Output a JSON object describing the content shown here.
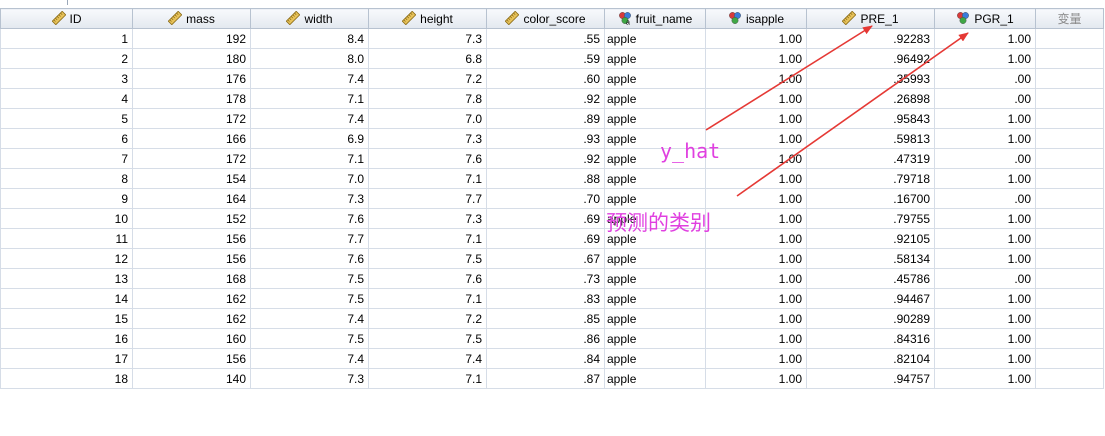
{
  "columns": [
    {
      "label": "ID",
      "icon": "ruler-icon"
    },
    {
      "label": "mass",
      "icon": "ruler-icon"
    },
    {
      "label": "width",
      "icon": "ruler-icon"
    },
    {
      "label": "height",
      "icon": "ruler-icon"
    },
    {
      "label": "color_score",
      "icon": "ruler-icon"
    },
    {
      "label": "fruit_name",
      "icon": "nominal-string-icon"
    },
    {
      "label": "isapple",
      "icon": "nominal-icon"
    },
    {
      "label": "PRE_1",
      "icon": "ruler-icon"
    },
    {
      "label": "PGR_1",
      "icon": "nominal-icon"
    },
    {
      "label": "变量",
      "icon": ""
    }
  ],
  "rows": [
    {
      "id": "1",
      "mass": "192",
      "width": "8.4",
      "height": "7.3",
      "color_score": ".55",
      "fruit_name": "apple",
      "isapple": "1.00",
      "pre_1": ".92283",
      "pgr_1": "1.00"
    },
    {
      "id": "2",
      "mass": "180",
      "width": "8.0",
      "height": "6.8",
      "color_score": ".59",
      "fruit_name": "apple",
      "isapple": "1.00",
      "pre_1": ".96492",
      "pgr_1": "1.00"
    },
    {
      "id": "3",
      "mass": "176",
      "width": "7.4",
      "height": "7.2",
      "color_score": ".60",
      "fruit_name": "apple",
      "isapple": "1.00",
      "pre_1": ".35993",
      "pgr_1": ".00"
    },
    {
      "id": "4",
      "mass": "178",
      "width": "7.1",
      "height": "7.8",
      "color_score": ".92",
      "fruit_name": "apple",
      "isapple": "1.00",
      "pre_1": ".26898",
      "pgr_1": ".00"
    },
    {
      "id": "5",
      "mass": "172",
      "width": "7.4",
      "height": "7.0",
      "color_score": ".89",
      "fruit_name": "apple",
      "isapple": "1.00",
      "pre_1": ".95843",
      "pgr_1": "1.00"
    },
    {
      "id": "6",
      "mass": "166",
      "width": "6.9",
      "height": "7.3",
      "color_score": ".93",
      "fruit_name": "apple",
      "isapple": "1.00",
      "pre_1": ".59813",
      "pgr_1": "1.00"
    },
    {
      "id": "7",
      "mass": "172",
      "width": "7.1",
      "height": "7.6",
      "color_score": ".92",
      "fruit_name": "apple",
      "isapple": "1.00",
      "pre_1": ".47319",
      "pgr_1": ".00"
    },
    {
      "id": "8",
      "mass": "154",
      "width": "7.0",
      "height": "7.1",
      "color_score": ".88",
      "fruit_name": "apple",
      "isapple": "1.00",
      "pre_1": ".79718",
      "pgr_1": "1.00"
    },
    {
      "id": "9",
      "mass": "164",
      "width": "7.3",
      "height": "7.7",
      "color_score": ".70",
      "fruit_name": "apple",
      "isapple": "1.00",
      "pre_1": ".16700",
      "pgr_1": ".00"
    },
    {
      "id": "10",
      "mass": "152",
      "width": "7.6",
      "height": "7.3",
      "color_score": ".69",
      "fruit_name": "apple",
      "isapple": "1.00",
      "pre_1": ".79755",
      "pgr_1": "1.00"
    },
    {
      "id": "11",
      "mass": "156",
      "width": "7.7",
      "height": "7.1",
      "color_score": ".69",
      "fruit_name": "apple",
      "isapple": "1.00",
      "pre_1": ".92105",
      "pgr_1": "1.00"
    },
    {
      "id": "12",
      "mass": "156",
      "width": "7.6",
      "height": "7.5",
      "color_score": ".67",
      "fruit_name": "apple",
      "isapple": "1.00",
      "pre_1": ".58134",
      "pgr_1": "1.00"
    },
    {
      "id": "13",
      "mass": "168",
      "width": "7.5",
      "height": "7.6",
      "color_score": ".73",
      "fruit_name": "apple",
      "isapple": "1.00",
      "pre_1": ".45786",
      "pgr_1": ".00"
    },
    {
      "id": "14",
      "mass": "162",
      "width": "7.5",
      "height": "7.1",
      "color_score": ".83",
      "fruit_name": "apple",
      "isapple": "1.00",
      "pre_1": ".94467",
      "pgr_1": "1.00"
    },
    {
      "id": "15",
      "mass": "162",
      "width": "7.4",
      "height": "7.2",
      "color_score": ".85",
      "fruit_name": "apple",
      "isapple": "1.00",
      "pre_1": ".90289",
      "pgr_1": "1.00"
    },
    {
      "id": "16",
      "mass": "160",
      "width": "7.5",
      "height": "7.5",
      "color_score": ".86",
      "fruit_name": "apple",
      "isapple": "1.00",
      "pre_1": ".84316",
      "pgr_1": "1.00"
    },
    {
      "id": "17",
      "mass": "156",
      "width": "7.4",
      "height": "7.4",
      "color_score": ".84",
      "fruit_name": "apple",
      "isapple": "1.00",
      "pre_1": ".82104",
      "pgr_1": "1.00"
    },
    {
      "id": "18",
      "mass": "140",
      "width": "7.3",
      "height": "7.1",
      "color_score": ".87",
      "fruit_name": "apple",
      "isapple": "1.00",
      "pre_1": ".94757",
      "pgr_1": "1.00"
    }
  ],
  "annotations": {
    "y_hat": "y_hat",
    "predicted_class": "预测的类别"
  },
  "colors": {
    "annotation_text": "#e040e0",
    "arrow": "#e53935",
    "header_border": "#b7c2d0",
    "cell_border": "#d6dde7"
  }
}
